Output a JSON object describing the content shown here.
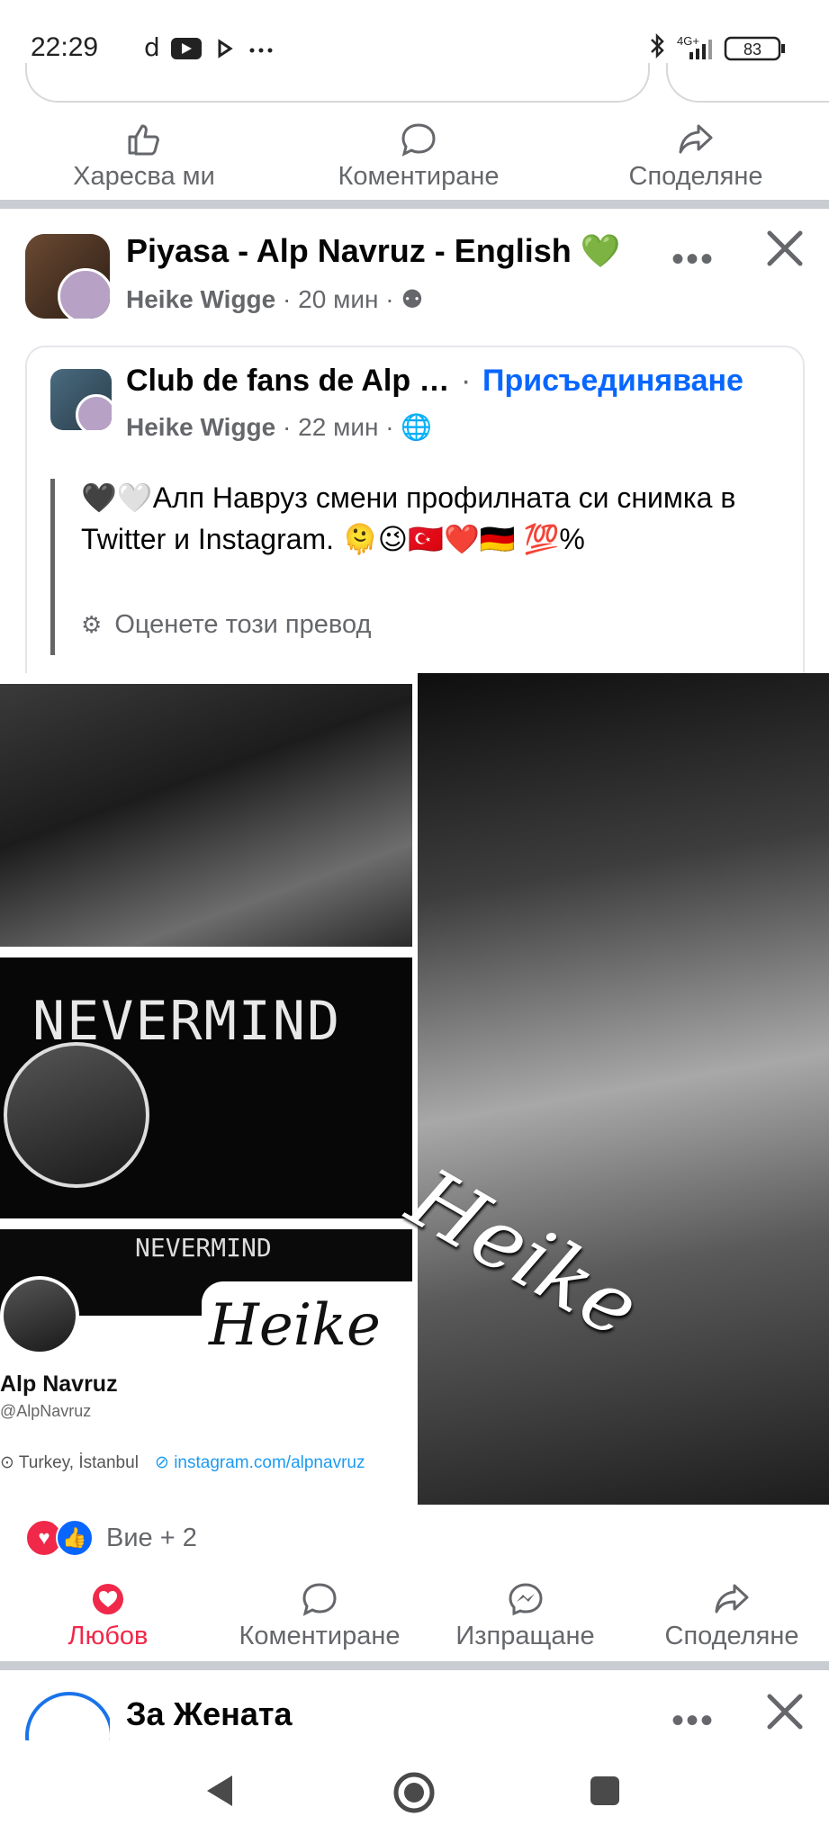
{
  "status": {
    "time": "22:29",
    "network": "4G+",
    "battery": "83"
  },
  "prev_post_actions": {
    "like": "Харесва ми",
    "comment": "Коментиране",
    "share": "Споделяне"
  },
  "post": {
    "group_title": "Piyasa - Alp Navruz - English 💚",
    "author": "Heike Wigge",
    "time": "20 мин",
    "shared": {
      "title": "Club de fans de Alp …",
      "join": "Присъединяване",
      "author": "Heike Wigge",
      "time": "22 мин"
    },
    "text": "🖤🤍Алп Навруз смени профилната си снимка в Twitter и Instagram. 🫠😉🇹🇷❤️🇩🇪 💯%",
    "rate_translation": "Оценете този превод",
    "images": {
      "nevermind": "NEVERMIND",
      "watermark": "Heike",
      "profile_name": "Alp Navruz",
      "profile_handle": "@AlpNavruz",
      "location": "Turkey, İstanbul",
      "link": "instagram.com/alpnavruz"
    },
    "reactions": "Вие + 2",
    "actions": {
      "love": "Любов",
      "comment": "Коментиране",
      "send": "Изпращане",
      "share": "Споделяне"
    }
  },
  "next_post": {
    "title": "За Жената"
  },
  "colors": {
    "love": "#f02849",
    "link": "#0866ff",
    "secondary": "#65676b"
  }
}
